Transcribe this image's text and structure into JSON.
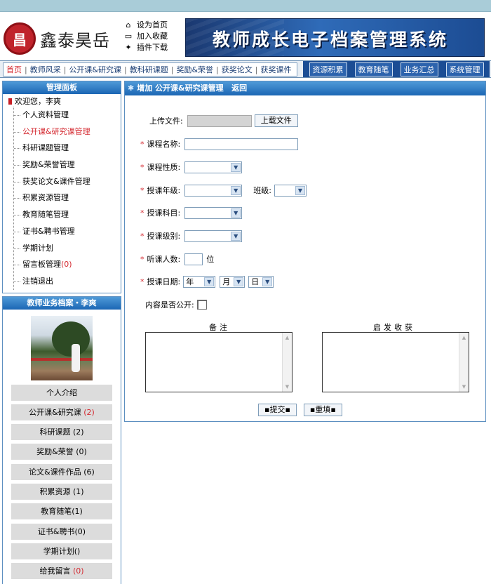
{
  "header": {
    "logo_seal": "昌",
    "logo_text": "鑫泰昊岳",
    "quick_links": [
      {
        "icon": "home-icon",
        "glyph": "⌂",
        "label": "设为首页"
      },
      {
        "icon": "folder-icon",
        "glyph": "▭",
        "label": "加入收藏"
      },
      {
        "icon": "plugin-icon",
        "glyph": "✦",
        "label": "插件下载"
      }
    ],
    "banner_title": "教师成长电子档案管理系统"
  },
  "nav": {
    "left": [
      "首页",
      "教师风采",
      "公开课&研究课",
      "教科研课题",
      "奖励&荣誉",
      "获奖论文",
      "获奖课件"
    ],
    "right": [
      "资源积累",
      "教育随笔",
      "业务汇总",
      "系统管理"
    ]
  },
  "sidebar": {
    "manage_title": "管理面板",
    "welcome": "欢迎您，李爽",
    "items": [
      {
        "label": "个人资料管理"
      },
      {
        "label": "公开课&研究课管理"
      },
      {
        "label": "科研课题管理"
      },
      {
        "label": "奖励&荣誉管理"
      },
      {
        "label": "获奖论文&课件管理"
      },
      {
        "label": "积累资源管理"
      },
      {
        "label": "教育随笔管理"
      },
      {
        "label": "证书&聘书管理"
      },
      {
        "label": "学期计划"
      },
      {
        "label": "留言板管理",
        "count": "(0)"
      },
      {
        "label": "注销退出"
      }
    ],
    "archive_title": "教师业务档案・李爽",
    "archive_items": [
      {
        "label": "个人介绍",
        "count": ""
      },
      {
        "label": "公开课&研究课",
        "count": "(2)"
      },
      {
        "label": "科研课题",
        "count": "(2)"
      },
      {
        "label": "奖励&荣誉",
        "count": "(0)"
      },
      {
        "label": "论文&课件作品",
        "count": "(6)"
      },
      {
        "label": "积累资源",
        "count": "(1)"
      },
      {
        "label": "教育随笔",
        "count": "(1)"
      },
      {
        "label": "证书&聘书",
        "count": "(0)"
      },
      {
        "label": "学期计划",
        "count": "()"
      },
      {
        "label": "给我留言",
        "count": "(0)"
      }
    ]
  },
  "form": {
    "header": "增加 公开课&研究课管理",
    "back": "返回",
    "upload_label": "上传文件:",
    "upload_button": "上载文件",
    "course_name_label": "课程名称:",
    "course_type_label": "课程性质:",
    "grade_label": "授课年级:",
    "class_label": "班级:",
    "subject_label": "授课科目:",
    "level_label": "授课级别:",
    "audience_label": "听课人数:",
    "audience_unit": "位",
    "date_label": "授课日期:",
    "year": "年",
    "month": "月",
    "day": "日",
    "public_label": "内容是否公开:",
    "remark_label": "备注",
    "inspire_label": "启发收获",
    "submit": "▪提交▪",
    "reset": "▪重填▪"
  }
}
